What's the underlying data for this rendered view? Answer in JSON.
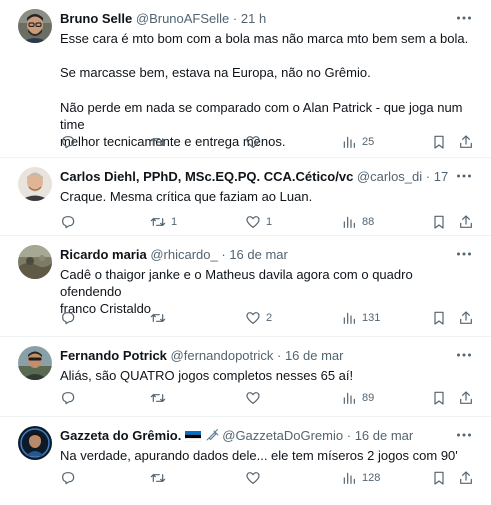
{
  "tweets": [
    {
      "name": "Bruno Selle",
      "handle": "@BrunoAFSelle",
      "time": "21 h",
      "lines": [
        "Esse cara é mto bom com a bola mas não marca mto bem sem a bola.",
        "",
        "Se marcasse bem, estava na Europa, não no Grêmio.",
        "",
        "Não perde em nada se comparado com o Alan Patrick - que joga num time",
        "melhor tecnicamente e entrega menos."
      ],
      "reply_count": "",
      "retweet_count": "",
      "like_count": "",
      "view_count": "25"
    },
    {
      "name": "Carlos Diehl, PPhD, MSc.EQ.PQ. CCA.Cético/vc",
      "handle": "@carlos_di",
      "time": "17 de mar",
      "lines": [
        "Craque. Mesma crítica que faziam ao Luan."
      ],
      "reply_count": "",
      "retweet_count": "1",
      "like_count": "1",
      "view_count": "88"
    },
    {
      "name": "Ricardo maria",
      "handle": "@rhicardo_",
      "time": "16 de mar",
      "lines": [
        "Cadê o thaigor janke e o Matheus davila agora com o quadro ofendendo",
        "franco Cristaldo"
      ],
      "reply_count": "",
      "retweet_count": "",
      "like_count": "2",
      "view_count": "131"
    },
    {
      "name": "Fernando Potrick",
      "handle": "@fernandopotrick",
      "time": "16 de mar",
      "lines": [
        "Aliás, são QUATRO jogos completos nesses 65 aí!"
      ],
      "reply_count": "",
      "retweet_count": "",
      "like_count": "",
      "view_count": "89"
    },
    {
      "name": "Gazzeta do Grêmio.",
      "name_icons": [
        "estonian-flag-icon",
        "syringe-icon"
      ],
      "handle": "@GazzetaDoGremio",
      "time": "16 de mar",
      "lines": [
        "Na verdade, apurando dados dele... ele tem míseros 2 jogos com 90'"
      ],
      "reply_count": "",
      "retweet_count": "",
      "like_count": "",
      "view_count": "128"
    }
  ],
  "separator": "·",
  "colors": {
    "text_primary": "#0f1419",
    "text_secondary": "#536471",
    "divider": "#eff3f4",
    "background": "#ffffff"
  },
  "icons": [
    "reply-icon",
    "retweet-icon",
    "like-icon",
    "views-icon",
    "bookmark-icon",
    "share-icon",
    "more-options-icon"
  ]
}
